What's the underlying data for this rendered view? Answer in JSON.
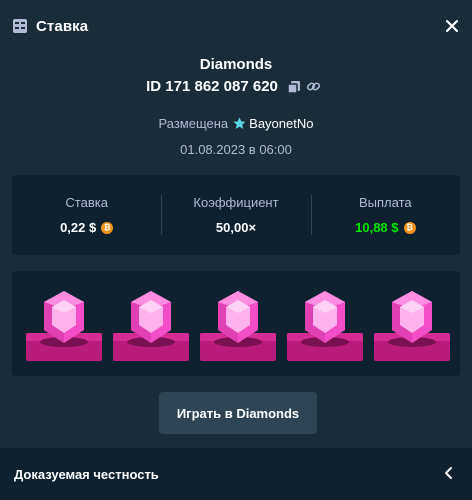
{
  "header": {
    "title": "Ставка",
    "icon": "bet-slip-icon",
    "close_icon": "close-icon"
  },
  "bet": {
    "game": "Diamonds",
    "id_text": "ID 171 862 087 620",
    "placed_label": "Размещена",
    "user": "BayonetNo",
    "date": "01.08.2023 в 06:00"
  },
  "stats": {
    "stake_label": "Ставка",
    "stake_value": "0,22 $",
    "multiplier_label": "Коэффициент",
    "multiplier_value": "50,00×",
    "payout_label": "Выплата",
    "payout_value": "10,88 $",
    "currency_icon": "bitcoin-icon",
    "payout_color": "#00e701"
  },
  "gems": {
    "count": 5,
    "type": "pink-diamond",
    "color": "#f34ec8"
  },
  "play_button": {
    "label": "Играть в Diamonds"
  },
  "fairness": {
    "label": "Доказуемая честность",
    "icon": "chevron-left-icon"
  },
  "colors": {
    "background": "#1a2c38",
    "panel": "#0f212e",
    "button": "#2f4553",
    "gem_plate": "#b91b7d"
  }
}
